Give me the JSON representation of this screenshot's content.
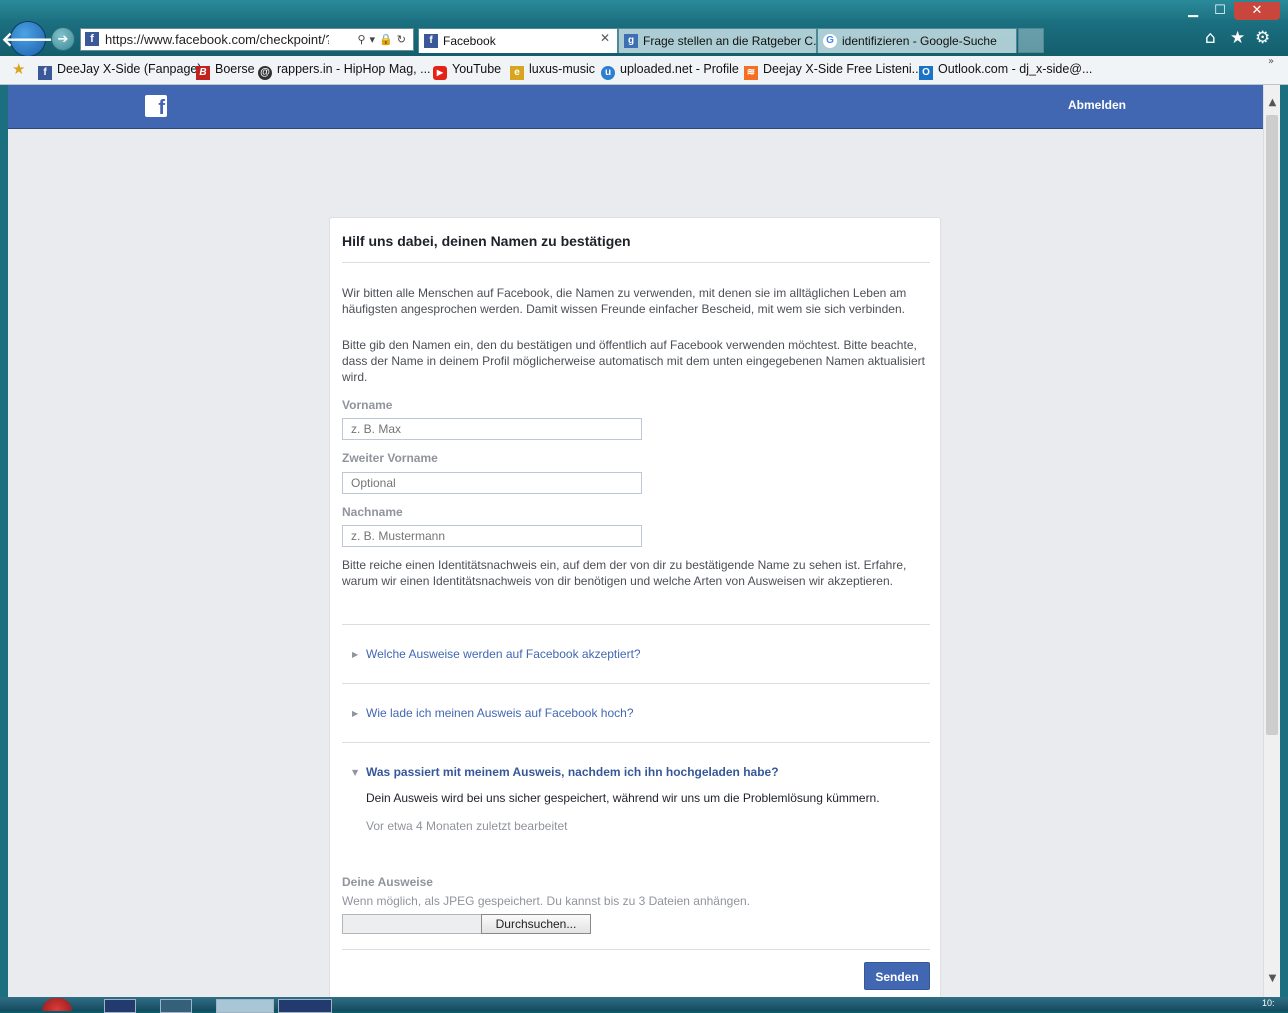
{
  "window_controls": {
    "minimize": "▁",
    "maximize": "☐",
    "close": "✕"
  },
  "nav": {
    "back_icon": "back-arrow-icon",
    "forward_icon": "forward-arrow-icon"
  },
  "address_bar": {
    "url": "https://www.facebook.com/checkpoint/?nex",
    "icons": "⚲▾🔒↻"
  },
  "tabs": [
    {
      "label": "Facebook",
      "favicon": "f",
      "active": true
    },
    {
      "label": "Frage stellen an die Ratgeber C...",
      "favicon": "g"
    },
    {
      "label": "identifizieren - Google-Suche",
      "favicon": "G"
    }
  ],
  "tab_close": "✕",
  "toolbar_icons": {
    "home": "⌂",
    "star": "★",
    "gear": "⚙"
  },
  "favorites": [
    {
      "label": "DeeJay X-Side (Fanpage)",
      "icon": "f",
      "color": "#3b5998"
    },
    {
      "label": "Boerse",
      "icon": "B",
      "color": "#c0241f"
    },
    {
      "label": "rappers.in - HipHop Mag, ...",
      "icon": "@",
      "color": "#333333"
    },
    {
      "label": "YouTube",
      "icon": "▶",
      "color": "#e62117"
    },
    {
      "label": "luxus-music",
      "icon": "e",
      "color": "#d9a520"
    },
    {
      "label": "uploaded.net - Profile",
      "icon": "u",
      "color": "#2e7fd0"
    },
    {
      "label": "Deejay X-Side  Free Listeni...",
      "icon": "≋",
      "color": "#f26f23"
    },
    {
      "label": "Outlook.com - dj_x-side@...",
      "icon": "O",
      "color": "#1a73c6"
    }
  ],
  "facebook": {
    "logo": "f",
    "logout": "Abmelden",
    "card": {
      "title": "Hilf uns dabei, deinen Namen zu bestätigen",
      "intro": "Wir bitten alle Menschen auf Facebook, die Namen zu verwenden, mit denen sie im alltäglichen Leben am häufigsten angesprochen werden. Damit wissen Freunde einfacher Bescheid, mit wem sie sich verbinden.",
      "instructions": "Bitte gib den Namen ein, den du bestätigen und öffentlich auf Facebook verwenden möchtest. Bitte beachte, dass der Name in deinem Profil möglicherweise automatisch mit dem unten eingegebenen Namen aktualisiert wird.",
      "fields": {
        "first_name": {
          "label": "Vorname",
          "placeholder": "z. B. Max"
        },
        "middle_name": {
          "label": "Zweiter Vorname",
          "placeholder": "Optional"
        },
        "last_name": {
          "label": "Nachname",
          "placeholder": "z. B. Mustermann"
        }
      },
      "id_request": "Bitte reiche einen Identitätsnachweis ein, auf dem der von dir zu bestätigende Name zu sehen ist. Erfahre, warum wir einen Identitätsnachweis von dir benötigen und welche Arten von Ausweisen wir akzeptieren.",
      "faq": [
        {
          "question": "Welche Ausweise werden auf Facebook akzeptiert?",
          "arrow": "▶"
        },
        {
          "question": "Wie lade ich meinen Ausweis auf Facebook hoch?",
          "arrow": "▶"
        },
        {
          "question": "Was passiert mit meinem Ausweis, nachdem ich ihn hochgeladen habe?",
          "arrow": "▼",
          "answer": "Dein Ausweis wird bei uns sicher gespeichert, während wir uns um die Problemlösung kümmern.",
          "edited": "Vor etwa 4 Monaten zuletzt bearbeitet"
        }
      ],
      "ids_label": "Deine Ausweise",
      "ids_hint": "Wenn möglich, als JPEG gespeichert. Du kannst bis zu 3 Dateien anhängen.",
      "browse": "Durchsuchen...",
      "submit": "Senden"
    }
  },
  "scrollbar": {
    "up": "▲",
    "down": "▼"
  },
  "taskbar": {
    "clock": "10:"
  }
}
